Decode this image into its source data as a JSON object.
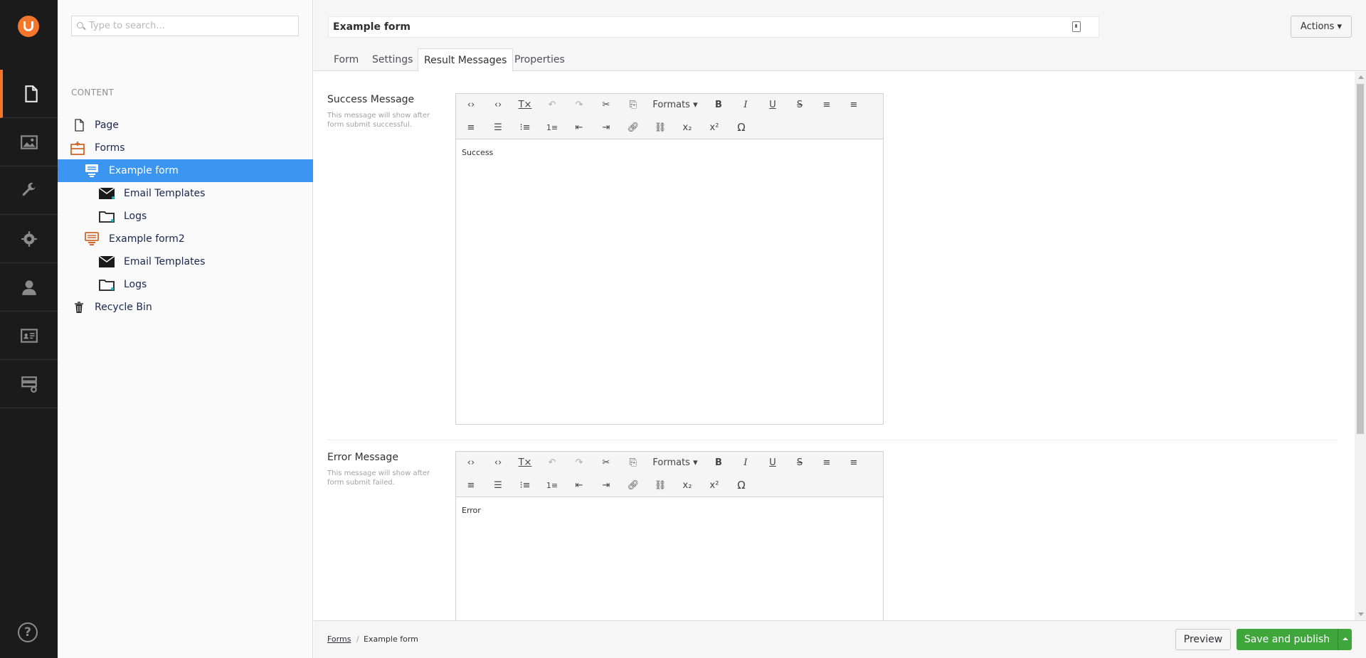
{
  "search": {
    "placeholder": "Type to search..."
  },
  "tree": {
    "header": "CONTENT",
    "nodes": [
      {
        "label": "Page",
        "icon": "document-icon"
      },
      {
        "label": "Forms",
        "icon": "forms-icon"
      },
      {
        "label": "Example form",
        "icon": "form-icon"
      },
      {
        "label": "Email Templates",
        "icon": "envelope-icon"
      },
      {
        "label": "Logs",
        "icon": "folder-icon"
      },
      {
        "label": "Example form2",
        "icon": "form-icon"
      },
      {
        "label": "Email Templates",
        "icon": "envelope-icon"
      },
      {
        "label": "Logs",
        "icon": "folder-icon"
      },
      {
        "label": "Recycle Bin",
        "icon": "trash-icon"
      }
    ]
  },
  "header": {
    "name_value": "Example form",
    "actions_label": "Actions ▾"
  },
  "tabs": [
    {
      "label": "Form"
    },
    {
      "label": "Settings"
    },
    {
      "label": "Result Messages"
    },
    {
      "label": "Properties"
    }
  ],
  "toolbar": {
    "formats_label": "Formats ▾"
  },
  "success": {
    "label": "Success Message",
    "description": "This message will show after form submit successful.",
    "body": "Success"
  },
  "error": {
    "label": "Error Message",
    "description": "This message will show after form submit failed.",
    "body": "Error"
  },
  "footer": {
    "crumb_root": "Forms",
    "crumb_sep": "/",
    "crumb_current": "Example form",
    "preview_label": "Preview",
    "save_label": "Save and publish"
  },
  "colors": {
    "brand": "#f5752a",
    "selected": "#3a96f0",
    "publish": "#3ea63b",
    "appbar": "#1b1b1b"
  }
}
